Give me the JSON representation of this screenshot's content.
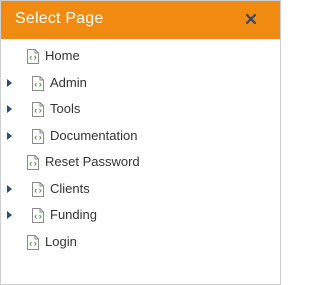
{
  "dialog": {
    "title": "Select Page",
    "close_icon": "close-icon"
  },
  "tree": {
    "items": [
      {
        "label": "Home",
        "expandable": false,
        "icon": "page-code-icon"
      },
      {
        "label": "Admin",
        "expandable": true,
        "icon": "page-code-icon"
      },
      {
        "label": "Tools",
        "expandable": true,
        "icon": "page-code-icon"
      },
      {
        "label": "Documentation",
        "expandable": true,
        "icon": "page-code-icon"
      },
      {
        "label": "Reset Password",
        "expandable": false,
        "icon": "page-code-icon"
      },
      {
        "label": "Clients",
        "expandable": true,
        "icon": "page-code-icon"
      },
      {
        "label": "Funding",
        "expandable": true,
        "icon": "page-code-icon"
      },
      {
        "label": "Login",
        "expandable": false,
        "icon": "page-code-icon"
      }
    ]
  },
  "colors": {
    "titlebar": "#f18a10",
    "close_icon": "#2f4a6b",
    "text": "#333333",
    "toggle_arrow": "#2f4a6b",
    "page_icon_accent": "#5a9a4a"
  }
}
